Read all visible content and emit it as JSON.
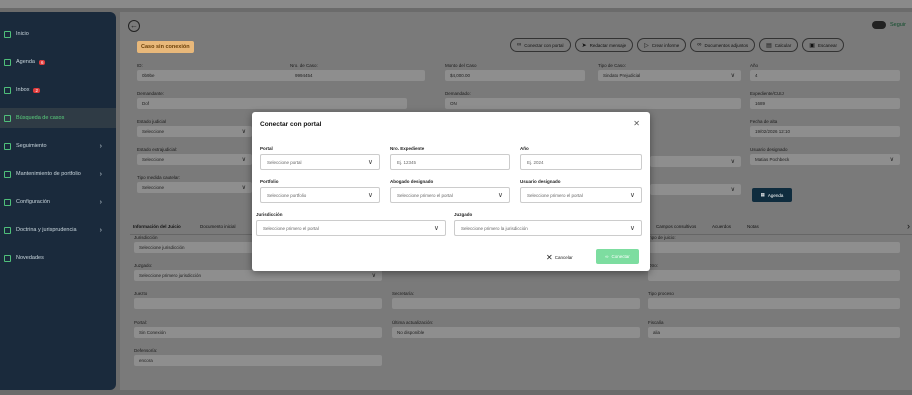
{
  "sidebar": {
    "items": [
      {
        "label": "Inicio",
        "badge": "",
        "chevron": false
      },
      {
        "label": "Agenda",
        "badge": "6",
        "chevron": false
      },
      {
        "label": "Inbox",
        "badge": "2",
        "chevron": false
      },
      {
        "label": "Búsqueda de casos",
        "badge": "",
        "chevron": false,
        "active": true
      },
      {
        "label": "Seguimiento",
        "badge": "",
        "chevron": true
      },
      {
        "label": "Mantenimiento de portfolio",
        "badge": "",
        "chevron": true
      },
      {
        "label": "Configuración",
        "badge": "",
        "chevron": true
      },
      {
        "label": "Doctrina y jurisprudencia",
        "badge": "",
        "chevron": true
      },
      {
        "label": "Novedades",
        "badge": "",
        "chevron": false
      }
    ]
  },
  "header": {
    "status_badge": "Caso sin conexión",
    "follow_label": "Seguir",
    "toolbar": {
      "connect": "Conectar con portal",
      "draft": "Redactar mensaje",
      "report": "Crear informe",
      "docs": "Documentos adjuntos",
      "calc": "Calcular",
      "scan": "Escanear"
    }
  },
  "case_fields": {
    "id_label": "ID:",
    "id_value": "0b9be",
    "case_nro_label": "Nro. de Caso:",
    "case_nro_value": "9994454",
    "amount_label": "Monto del Caso",
    "amount_value": "$4,000.00",
    "type_label": "Tipo de Caso:",
    "type_value": "Sindato Prejudicial",
    "year_label": "Año",
    "year_value": "4",
    "plaintiff_label": "Demandante:",
    "plaintiff_value": "Dof",
    "defendant_label": "Demandado:",
    "defendant_value": "ON",
    "file_label": "Expediente/CUIJ",
    "file_value": "1689",
    "judicial_label": "Estado judicial",
    "judicial_value": "Seleccione",
    "alta_label": "Fecha de alta",
    "alta_value": "19/02/2026 12:10",
    "extra_label": "Estado extrajudicial:",
    "extra_value": "Seleccione",
    "user_label": "Usuario designado",
    "user_value": "Matias Pochbeck",
    "cautelar_label": "Tipo medida cautelar:",
    "cautelar_value": "Seleccione",
    "agenda_button": "Agenda"
  },
  "tabs": [
    "Información del Juicio",
    "Documento inicial",
    "Campos consultivos",
    "Acuerdos",
    "Notas"
  ],
  "lower_fields": {
    "jurisdiccion_label": "Jurisdicción",
    "jurisdiccion_value": "Seleccione jurisdicción",
    "juzgado_label": "Juzgado:",
    "juzgado_value": "Seleccione primero jurisdicción",
    "juezo_label": "Juezto",
    "juezo_value": "",
    "secretaria_label": "Secretaría:",
    "secretaria_value": "",
    "portal_label": "Portal:",
    "portal_value": "Sin Conexión",
    "ultima_label": "Última actualización:",
    "ultima_value": "No disponible",
    "defensoria_label": "Defensoría:",
    "defensoria_value": "encora",
    "tipo_juicio_label": "Tipo de juicio:",
    "tipo_juicio_value": "",
    "otro_label": "Otro:",
    "otro_value": "",
    "tipo_proceso_label": "Tipo proceso",
    "tipo_proceso_value": "",
    "fiscalia_label": "Fiscalía",
    "fiscalia_value": "alia"
  },
  "modal": {
    "title": "Conectar con portal",
    "portal_label": "Portal",
    "portal_placeholder": "Seleccione portal",
    "expediente_label": "Nro. Expediente",
    "expediente_placeholder": "Ej. 12345",
    "anio_label": "Año",
    "anio_placeholder": "Ej. 2024",
    "portfolio_label": "Portfolio",
    "portfolio_placeholder": "Seleccione portfolio",
    "abogado_label": "Abogado designado",
    "abogado_placeholder": "Seleccione primero el portal",
    "usuario_label": "Usuario designado",
    "usuario_placeholder": "Seleccione primero el portal",
    "jurisdiccion_label": "Jurisdicción",
    "jurisdiccion_placeholder": "Seleccione primero el portal",
    "juzgado_label": "Juzgado",
    "juzgado_placeholder": "Seleccione primero la jurisdicción",
    "cancel": "Cancelar",
    "connect": "Conectar"
  }
}
